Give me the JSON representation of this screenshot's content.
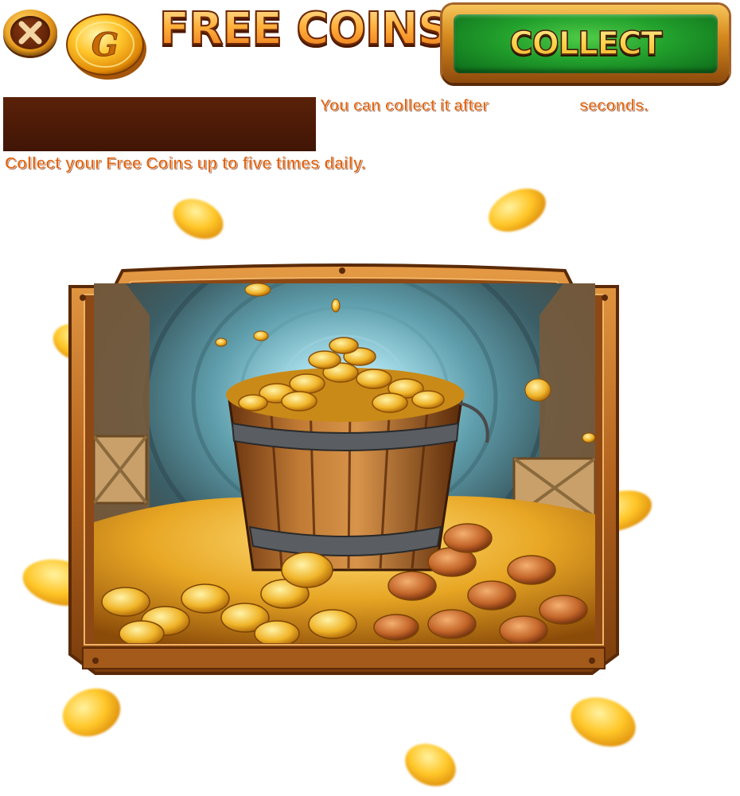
{
  "header": {
    "close_icon": "close-x-icon",
    "coin_icon": "gold-coin-g-icon",
    "coin_letter": "G",
    "title": "FREE COINS",
    "collect_label": "COLLECT"
  },
  "messages": {
    "after_prefix": "You can collect it after",
    "after_suffix": "seconds.",
    "daily_info": "Collect your Free Coins up to five times daily."
  },
  "artwork": {
    "subject": "bucket-of-gold-coins-illustration",
    "floating_coins": "gold-coin"
  },
  "colors": {
    "title_gold": "#ffb13c",
    "button_green": "#22a02c",
    "message_orange": "#e0620e",
    "timer_bar_brown": "#4a1806",
    "frame_wood": "#b5651f"
  }
}
